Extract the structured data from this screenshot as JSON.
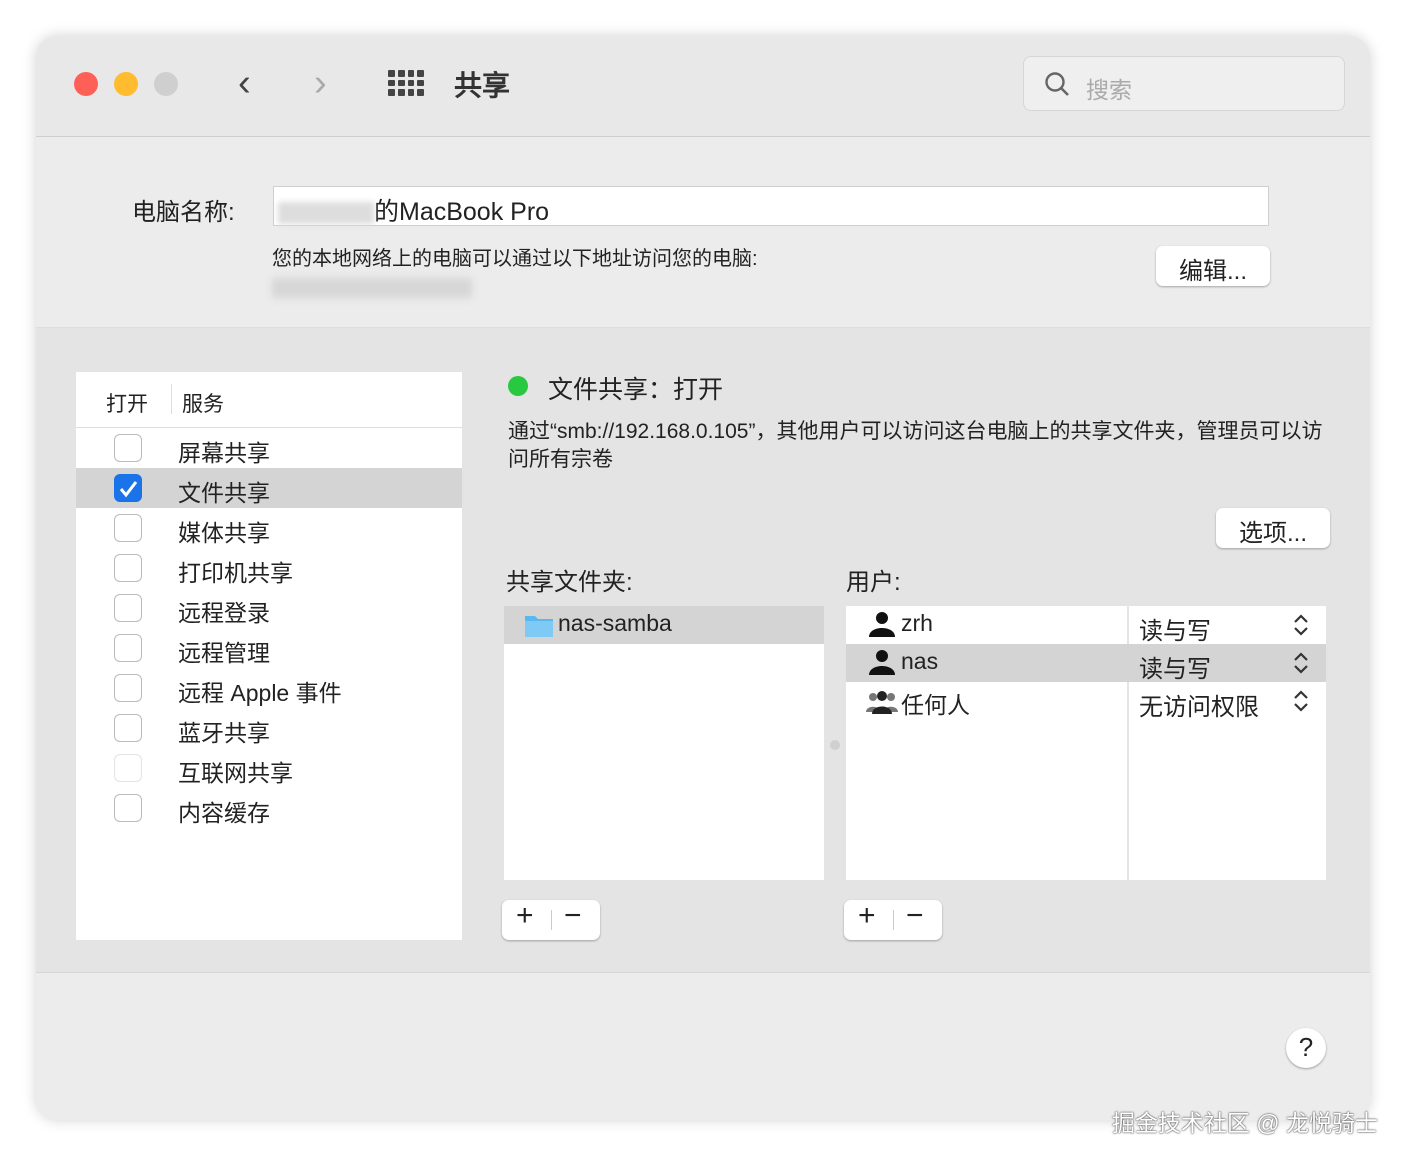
{
  "window": {
    "title": "共享",
    "search_placeholder": "搜索",
    "colors": {
      "close": "#fe5f57",
      "minimize": "#febc2e",
      "zoom": "#cfcfcf",
      "status_on": "#28c840",
      "accent": "#1a73e8"
    }
  },
  "computer": {
    "label": "电脑名称:",
    "name_suffix": "的MacBook Pro",
    "address_note": "您的本地网络上的电脑可以通过以下地址访问您的电脑:",
    "edit_button": "编辑..."
  },
  "services": {
    "col_on": "打开",
    "col_service": "服务",
    "items": [
      {
        "label": "屏幕共享",
        "checked": false
      },
      {
        "label": "文件共享",
        "checked": true,
        "selected": true
      },
      {
        "label": "媒体共享",
        "checked": false
      },
      {
        "label": "打印机共享",
        "checked": false
      },
      {
        "label": "远程登录",
        "checked": false
      },
      {
        "label": "远程管理",
        "checked": false
      },
      {
        "label": "远程 Apple 事件",
        "checked": false
      },
      {
        "label": "蓝牙共享",
        "checked": false
      },
      {
        "label": "互联网共享",
        "checked": false,
        "disabled": true
      },
      {
        "label": "内容缓存",
        "checked": false
      }
    ]
  },
  "detail": {
    "status": "文件共享：打开",
    "description": "通过“smb://192.168.0.105”，其他用户可以访问这台电脑上的共享文件夹，管理员可以访问所有宗卷",
    "options_button": "选项...",
    "folders_label": "共享文件夹:",
    "folders": [
      "nas-samba"
    ],
    "users_label": "用户:",
    "users": [
      {
        "name": "zrh",
        "perm": "读与写",
        "icon": "person-icon"
      },
      {
        "name": "nas",
        "perm": "读与写",
        "icon": "person-icon",
        "selected": true
      },
      {
        "name": "任何人",
        "perm": "无访问权限",
        "icon": "group-icon"
      }
    ]
  },
  "controls": {
    "add": "+",
    "remove": "−",
    "help": "?"
  },
  "watermark": "掘金技术社区 @ 龙悦骑士"
}
